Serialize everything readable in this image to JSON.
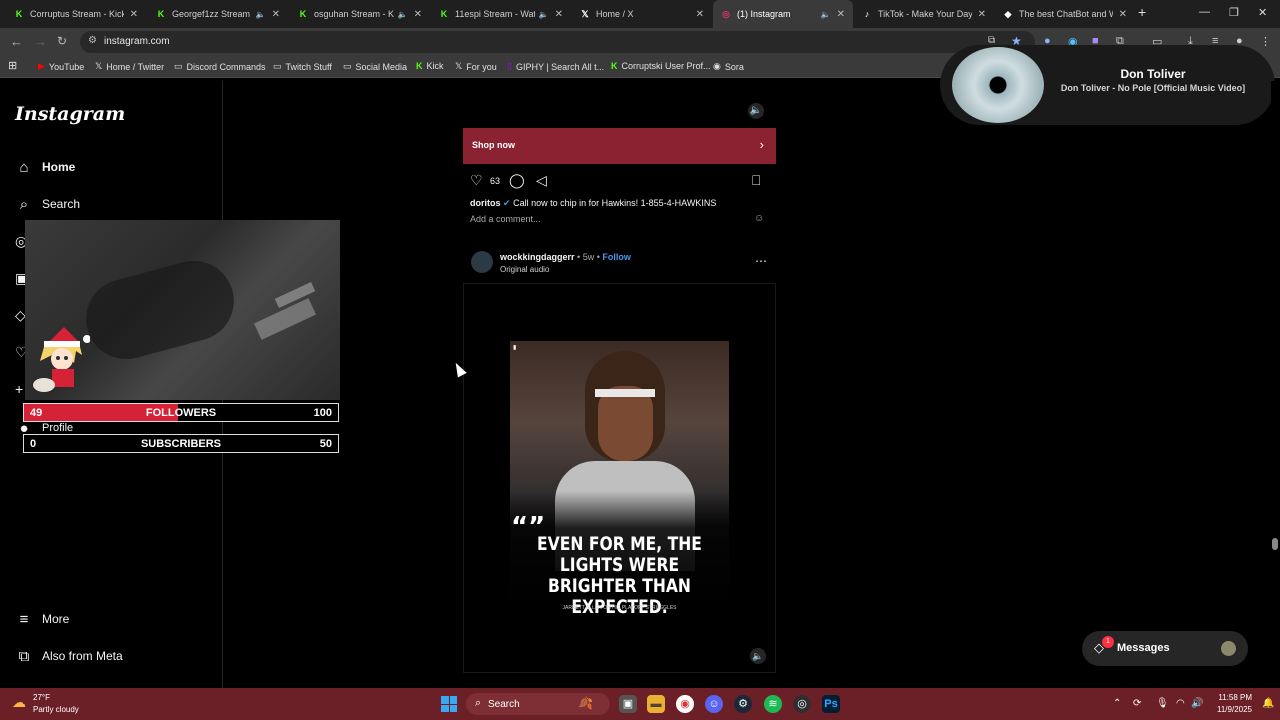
{
  "browser": {
    "tabs": [
      {
        "title": "Corruptus Stream - Kick D",
        "icon": "kick-icon"
      },
      {
        "title": "Georgef1zz Stream - V",
        "icon": "kick-icon"
      },
      {
        "title": "osguhan Stream - Kick",
        "icon": "kick-icon"
      },
      {
        "title": "11espi Stream - Watc",
        "icon": "kick-icon"
      },
      {
        "title": "Home / X",
        "icon": "x-icon"
      },
      {
        "title": "(1) Instagram",
        "icon": "instagram-icon"
      },
      {
        "title": "TikTok - Make Your Day",
        "icon": "tiktok-icon"
      },
      {
        "title": "The best ChatBot and Wid",
        "icon": "chatbot-icon"
      }
    ],
    "url": "instagram.com",
    "bookmarks": [
      {
        "label": "YouTube",
        "icon": "youtube-icon"
      },
      {
        "label": "Home / Twitter",
        "icon": "x-icon"
      },
      {
        "label": "Discord Commands",
        "icon": "folder-icon"
      },
      {
        "label": "Twitch Stuff",
        "icon": "folder-icon"
      },
      {
        "label": "Social Media",
        "icon": "folder-icon"
      },
      {
        "label": "Kick",
        "icon": "kick-icon"
      },
      {
        "label": "For you",
        "icon": "x-icon"
      },
      {
        "label": "GIPHY | Search All t...",
        "icon": "giphy-icon"
      },
      {
        "label": "Corruptski User Prof...",
        "icon": "kick-icon"
      },
      {
        "label": "Sora",
        "icon": "sora-icon"
      }
    ]
  },
  "instagram": {
    "logo": "Instagram",
    "nav": {
      "home": "Home",
      "search": "Search",
      "profile": "Profile",
      "more": "More",
      "also_from_meta": "Also from Meta"
    },
    "post1": {
      "cta": "Shop now",
      "likes": "63",
      "username": "doritos",
      "caption": "Call now to chip in for Hawkins! 1-855-4-HAWKINS",
      "add_comment": "Add a comment..."
    },
    "post2": {
      "username": "wockkingdaggerr",
      "age": "5w",
      "follow": "Follow",
      "audio": "Original audio",
      "quote_mark": "“”",
      "quote": "EVEN FOR ME, THE LIGHTS WERE BRIGHTER THAN EXPECTED.",
      "quote_credit": "JARRETT ALLEN ON HIS PLAYOFF STRUGGLES"
    },
    "messages": {
      "label": "Messages",
      "unread": "1"
    }
  },
  "stream_overlay": {
    "followers": {
      "current": "49",
      "label": "FOLLOWERS",
      "goal": "100",
      "progress": 0.49
    },
    "subscribers": {
      "current": "0",
      "label": "SUBSCRIBERS",
      "goal": "50",
      "progress": 0.0
    }
  },
  "now_playing": {
    "artist": "Don Toliver",
    "title": "Don Toliver - No Pole [Official Music Video]"
  },
  "taskbar": {
    "temperature": "27°F",
    "condition": "Partly cloudy",
    "search": "Search",
    "time": "11:58 PM",
    "date": "11/9/2025"
  },
  "colors": {
    "accent_red": "#d62236",
    "shop_bar": "#8b2232",
    "taskbar": "#6b1f26",
    "follow_blue": "#4a95f0"
  }
}
